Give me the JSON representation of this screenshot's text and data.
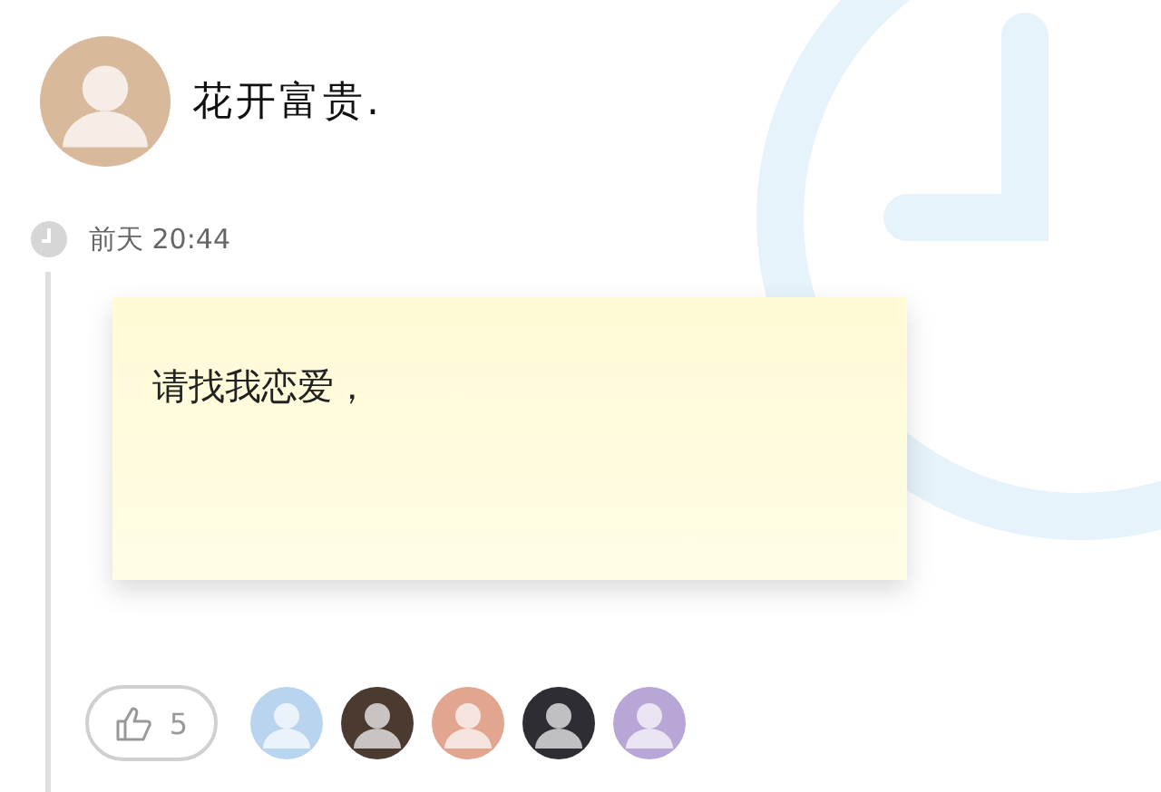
{
  "user": {
    "name": "花开富贵."
  },
  "post": {
    "time": "前天 20:44",
    "note": "请找我恋爱，"
  },
  "likes": {
    "count": "5",
    "liked": false
  },
  "likers": [
    {
      "kind": "avatar"
    },
    {
      "kind": "avatar"
    },
    {
      "kind": "avatar"
    },
    {
      "kind": "avatar"
    },
    {
      "kind": "avatar"
    }
  ]
}
